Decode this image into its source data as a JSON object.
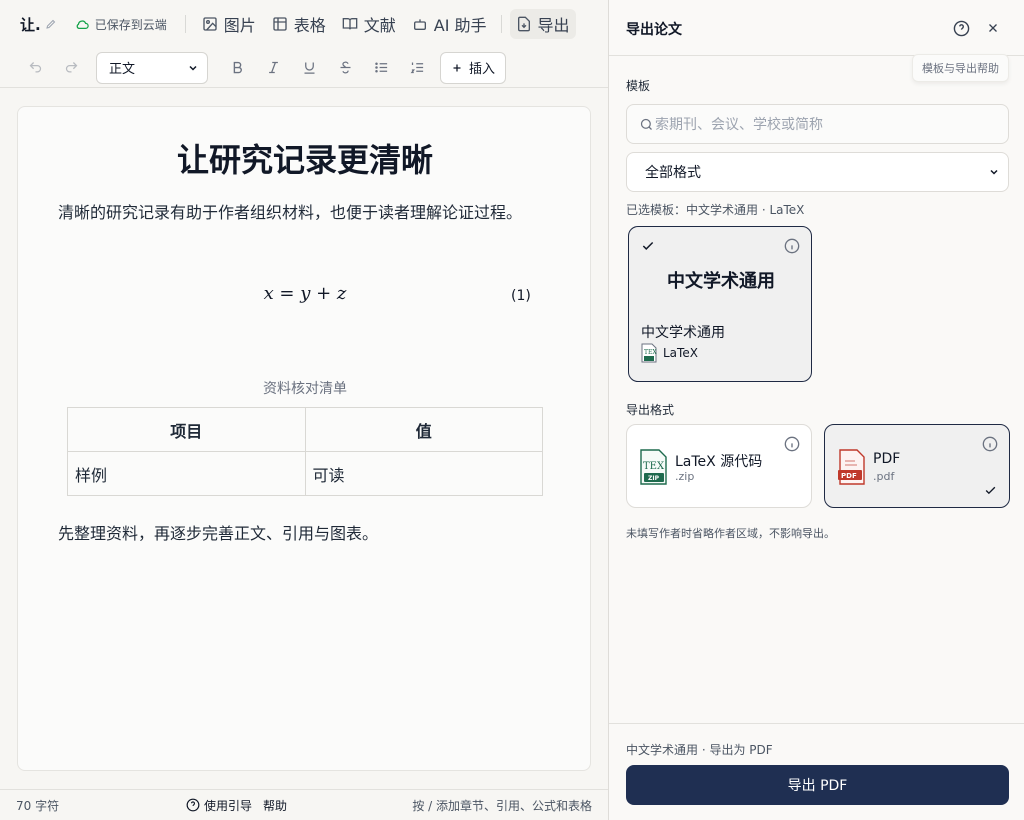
{
  "toolbar": {
    "doc_title": "让.",
    "save_status": "已保存到云端",
    "image": "图片",
    "table": "表格",
    "references": "文献",
    "ai": "AI 助手",
    "export": "导出"
  },
  "format": {
    "style_value": "正文",
    "insert": "插入"
  },
  "document": {
    "title": "让研究记录更清晰",
    "paragraph1": "清晰的研究记录有助于作者组织材料，也便于读者理解论证过程。",
    "equation": "x = y + z",
    "equation_number": "(1)",
    "table_caption": "资料核对清单",
    "table_headers": [
      "项目",
      "值"
    ],
    "table_rows": [
      [
        "样例",
        "可读"
      ]
    ],
    "paragraph2": "先整理资料，再逐步完善正文、引用与图表。"
  },
  "status": {
    "char_count": "70 字符",
    "guide": "使用引导",
    "help": "帮助",
    "hint": "按 / 添加章节、引用、公式和表格"
  },
  "panel": {
    "title": "导出论文",
    "tooltip": "模板与导出帮助",
    "template_label": "模板",
    "search_placeholder": "索期刊、会议、学校或简称",
    "filter_value": "全部格式",
    "selected_note": "已选模板：中文学术通用 · LaTeX",
    "template_card": {
      "big_title": "中文学术通用",
      "name": "中文学术通用",
      "engine": "LaTeX"
    },
    "format_label": "导出格式",
    "formats": [
      {
        "name": "LaTeX 源代码",
        "ext": ".zip",
        "badge": "TEX",
        "badge_sub": "ZIP"
      },
      {
        "name": "PDF",
        "ext": ".pdf",
        "badge": "PDF"
      }
    ],
    "omit_note": "未填写作者时省略作者区域，不影响导出。",
    "footer_note": "中文学术通用 · 导出为 PDF",
    "export_button": "导出 PDF"
  },
  "colors": {
    "accent": "#1f2f52",
    "cloud": "#16a34a",
    "latex_badge": "#1e6b4e",
    "pdf_badge": "#c0392b"
  }
}
